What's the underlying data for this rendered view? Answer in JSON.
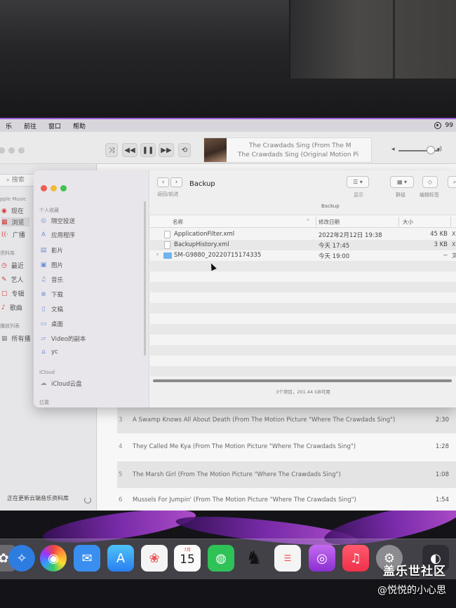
{
  "menubar": {
    "items": [
      "乐",
      "前往",
      "窗口",
      "帮助"
    ],
    "right_text": "99"
  },
  "player": {
    "now_playing_title": "The Crawdads Sing (From The M",
    "now_playing_album": "The Crawdads Sing (Original Motion Pi"
  },
  "music_sidebar": {
    "search_placeholder": "搜索",
    "section_apple_music": "pple Music",
    "apple_items": [
      {
        "label": "现在",
        "icon": "play-circle-icon"
      },
      {
        "label": "浏览",
        "icon": "grid-icon"
      },
      {
        "label": "广播",
        "icon": "radio-icon"
      }
    ],
    "section_library": "资料库",
    "library_items": [
      {
        "label": "最近",
        "icon": "clock-icon"
      },
      {
        "label": "艺人",
        "icon": "mic-icon"
      },
      {
        "label": "专辑",
        "icon": "album-icon"
      },
      {
        "label": "歌曲",
        "icon": "note-icon"
      }
    ],
    "section_playlists": "播放列表",
    "playlist_items": [
      {
        "label": "所有播",
        "icon": "grid-icon"
      }
    ],
    "status": "正在更新云端音乐资料库"
  },
  "tracks": [
    {
      "num": "3",
      "title": "A Swamp Knows All About Death (From The Motion Picture \"Where The Crawdads Sing\")",
      "duration": "2:30"
    },
    {
      "num": "4",
      "title": "They Called Me Kya (From The Motion Picture \"Where The Crawdads Sing\")",
      "duration": "1:28"
    },
    {
      "num": "5",
      "title": "The Marsh Girl (From The Motion Picture \"Where The Crawdads Sing\")",
      "duration": "1:08"
    },
    {
      "num": "6",
      "title": "Mussels For Jumpin' (From The Motion Picture \"Where The Crawdads Sing\")",
      "duration": "1:54"
    }
  ],
  "finder": {
    "sidebar": {
      "favorites_header": "个人收藏",
      "favorites": [
        {
          "label": "隔空投送",
          "icon": "airdrop-icon"
        },
        {
          "label": "应用程序",
          "icon": "apps-icon"
        },
        {
          "label": "影片",
          "icon": "film-icon"
        },
        {
          "label": "图片",
          "icon": "photo-icon"
        },
        {
          "label": "音乐",
          "icon": "music-note-icon"
        },
        {
          "label": "下载",
          "icon": "download-icon"
        },
        {
          "label": "文稿",
          "icon": "document-icon"
        },
        {
          "label": "桌面",
          "icon": "desktop-icon"
        },
        {
          "label": "Video的副本",
          "icon": "folder-icon"
        },
        {
          "label": "yc",
          "icon": "home-icon"
        }
      ],
      "icloud_header": "iCloud",
      "icloud_items": [
        {
          "label": "iCloud云盘",
          "icon": "cloud-icon"
        }
      ],
      "locations_header": "位置"
    },
    "toolbar": {
      "nav_back": "‹",
      "nav_forward": "›",
      "nav_label": "返回/前进",
      "folder_title": "Backup",
      "view_label": "显示",
      "group_label": "群组",
      "edit_tags_label": "编辑标签",
      "path_label": "Backup"
    },
    "columns": {
      "name": "名称",
      "modified": "修改日期",
      "size": "大小"
    },
    "files": [
      {
        "name": "ApplicationFilter.xml",
        "modified": "2022年2月12日 19:38",
        "size": "45 KB",
        "kind": "X",
        "type": "document"
      },
      {
        "name": "BackupHistory.xml",
        "modified": "今天 17:45",
        "size": "3 KB",
        "kind": "X",
        "type": "document"
      },
      {
        "name": "SM-G9880_20220715174335",
        "modified": "今天 19:00",
        "size": "--",
        "kind": "文",
        "type": "folder"
      }
    ],
    "status": "3个项目，201.44 GB可用"
  },
  "dock": {
    "calendar_month": "7月",
    "calendar_day": "15",
    "apps": [
      "photos",
      "safari",
      "aperture",
      "mail",
      "appstore",
      "photos-color",
      "calendar",
      "wechat",
      "qq",
      "reminders",
      "podcasts",
      "music",
      "settings",
      "other"
    ]
  },
  "watermark": {
    "line1": "盖乐世社区",
    "line2": "@悦悦的小心思"
  }
}
